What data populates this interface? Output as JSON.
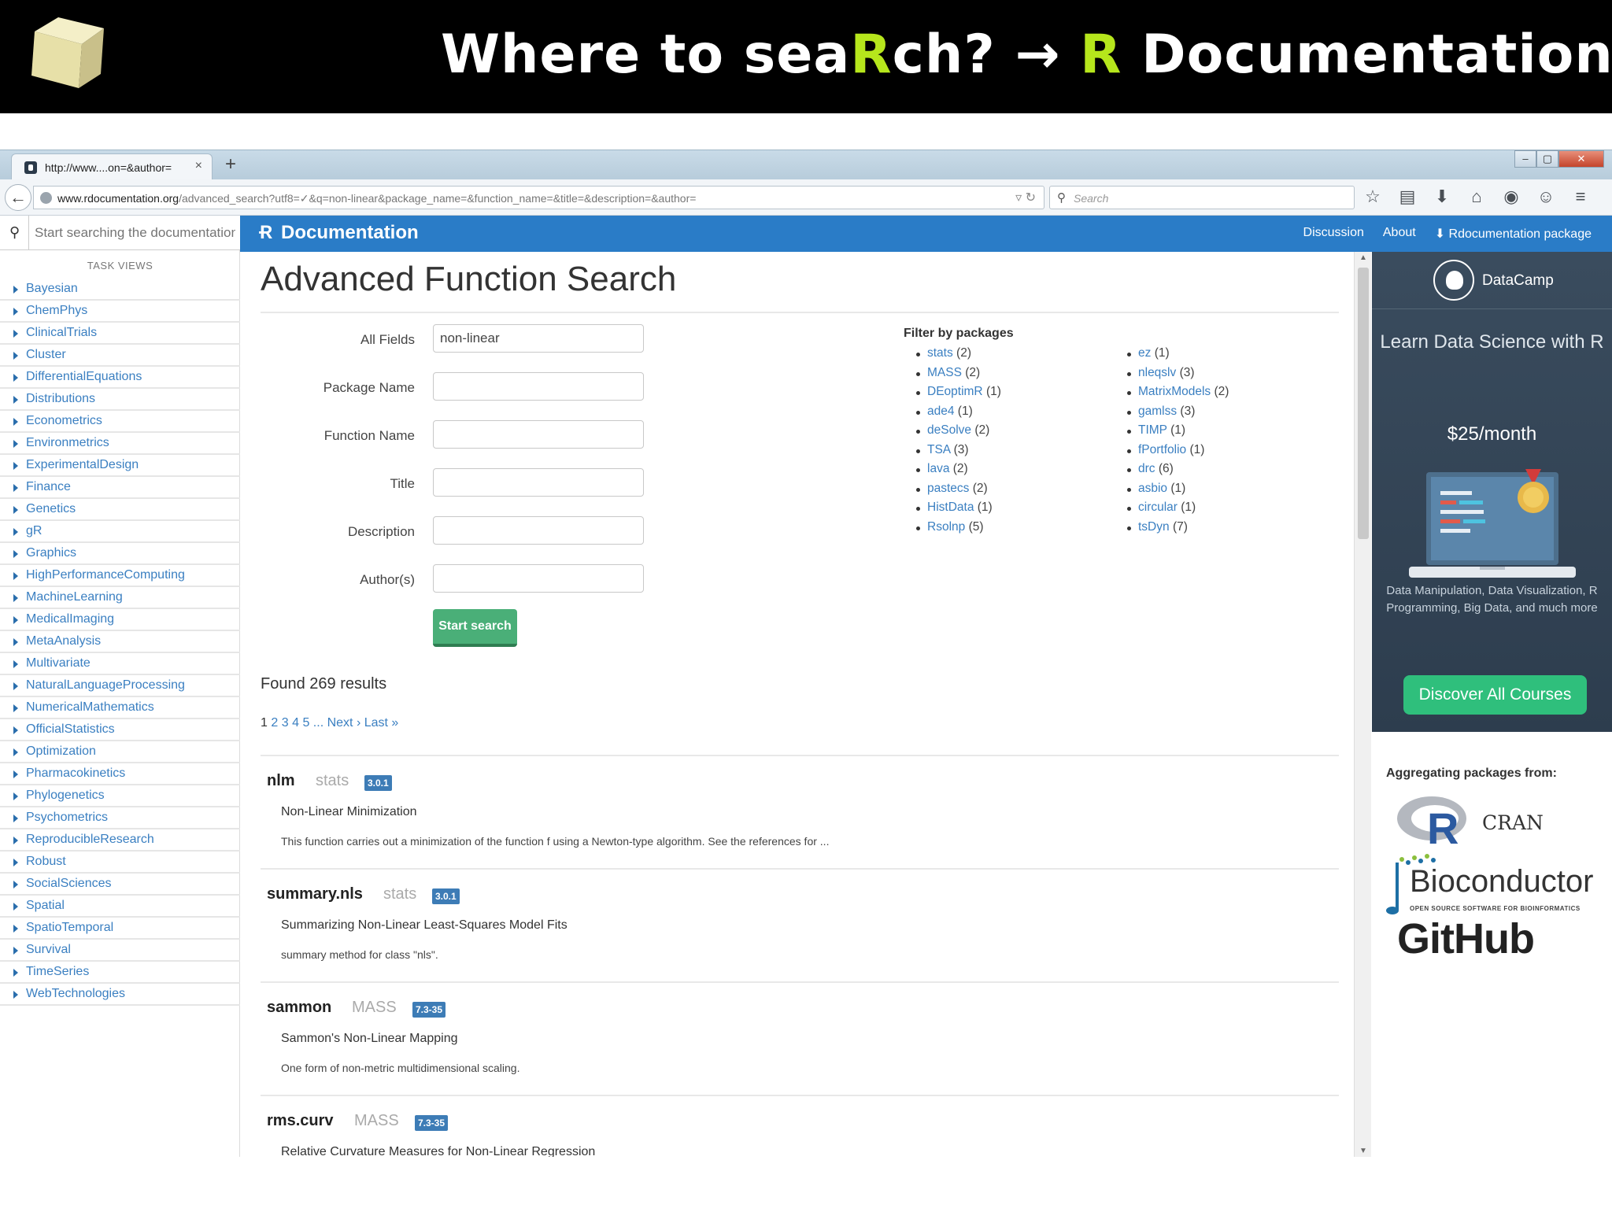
{
  "slide": {
    "title_pre": "Where to sea",
    "title_r": "R",
    "title_mid": "ch? → ",
    "title_r2": "R",
    "title_post": " Documentation",
    "accent_color": "#b6e61c"
  },
  "browser": {
    "tab_title": "http://www....on=&author=",
    "tab_close": "×",
    "new_tab": "+",
    "url_host": "www.rdocumentation.org",
    "url_path": "/advanced_search?utf8=✓&q=non-linear&package_name=&function_name=&title=&description=&author=",
    "search_placeholder": "Search"
  },
  "sidebar": {
    "search_placeholder": "Start searching the documentation",
    "task_views_label": "TASK VIEWS",
    "task_views": [
      "Bayesian",
      "ChemPhys",
      "ClinicalTrials",
      "Cluster",
      "DifferentialEquations",
      "Distributions",
      "Econometrics",
      "Environmetrics",
      "ExperimentalDesign",
      "Finance",
      "Genetics",
      "gR",
      "Graphics",
      "HighPerformanceComputing",
      "MachineLearning",
      "MedicalImaging",
      "MetaAnalysis",
      "Multivariate",
      "NaturalLanguageProcessing",
      "NumericalMathematics",
      "OfficialStatistics",
      "Optimization",
      "Pharmacokinetics",
      "Phylogenetics",
      "Psychometrics",
      "ReproducibleResearch",
      "Robust",
      "SocialSciences",
      "Spatial",
      "SpatioTemporal",
      "Survival",
      "TimeSeries",
      "WebTechnologies"
    ]
  },
  "topbar": {
    "brand": "Documentation",
    "links": [
      "Discussion",
      "About",
      "Rdocumentation package"
    ],
    "brand_color": "#2a7cc7"
  },
  "main": {
    "title": "Advanced Function Search",
    "form": {
      "all_fields_label": "All Fields",
      "all_fields_value": "non-linear",
      "package_name_label": "Package Name",
      "function_name_label": "Function Name",
      "title_label": "Title",
      "description_label": "Description",
      "authors_label": "Author(s)",
      "submit_label": "Start search"
    },
    "filter": {
      "heading": "Filter by packages",
      "col1": [
        {
          "name": "stats",
          "count": "(2)"
        },
        {
          "name": "MASS",
          "count": "(2)"
        },
        {
          "name": "DEoptimR",
          "count": "(1)"
        },
        {
          "name": "ade4",
          "count": "(1)"
        },
        {
          "name": "deSolve",
          "count": "(2)"
        },
        {
          "name": "TSA",
          "count": "(3)"
        },
        {
          "name": "lava",
          "count": "(2)"
        },
        {
          "name": "pastecs",
          "count": "(2)"
        },
        {
          "name": "HistData",
          "count": "(1)"
        },
        {
          "name": "Rsolnp",
          "count": "(5)"
        }
      ],
      "col2": [
        {
          "name": "ez",
          "count": "(1)"
        },
        {
          "name": "nleqslv",
          "count": "(3)"
        },
        {
          "name": "MatrixModels",
          "count": "(2)"
        },
        {
          "name": "gamlss",
          "count": "(3)"
        },
        {
          "name": "TIMP",
          "count": "(1)"
        },
        {
          "name": "fPortfolio",
          "count": "(1)"
        },
        {
          "name": "drc",
          "count": "(6)"
        },
        {
          "name": "asbio",
          "count": "(1)"
        },
        {
          "name": "circular",
          "count": "(1)"
        },
        {
          "name": "tsDyn",
          "count": "(7)"
        }
      ]
    },
    "found_text": "Found 269 results",
    "pager": {
      "current": "1",
      "pages": [
        "2",
        "3",
        "4",
        "5"
      ],
      "ellipsis": "...",
      "next": "Next ›",
      "last": "Last »"
    },
    "results": [
      {
        "name": "nlm",
        "package": "stats",
        "version": "3.0.1",
        "title": "Non-Linear Minimization",
        "description": "This function carries out a minimization of the function f using a Newton-type algorithm. See the references for ..."
      },
      {
        "name": "summary.nls",
        "package": "stats",
        "version": "3.0.1",
        "title": "Summarizing Non-Linear Least-Squares Model Fits",
        "description": "summary method for class \"nls\"."
      },
      {
        "name": "sammon",
        "package": "MASS",
        "version": "7.3-35",
        "title": "Sammon's Non-Linear Mapping",
        "description": "One form of non-metric multidimensional scaling."
      },
      {
        "name": "rms.curv",
        "package": "MASS",
        "version": "7.3-35",
        "title": "Relative Curvature Measures for Non-Linear Regression",
        "description": ""
      }
    ]
  },
  "ad": {
    "brand": "DataCamp",
    "headline": "Learn Data Science with R",
    "price": "$25/month",
    "features": "Data Manipulation, Data Visualization, R Programming, Big Data, and much more",
    "cta": "Discover All Courses"
  },
  "aggregating": {
    "heading": "Aggregating packages from:",
    "cran": "CRAN",
    "bioconductor": "Bioconductor",
    "bioconductor_sub": "OPEN SOURCE SOFTWARE FOR BIOINFORMATICS",
    "github": "GitHub"
  }
}
